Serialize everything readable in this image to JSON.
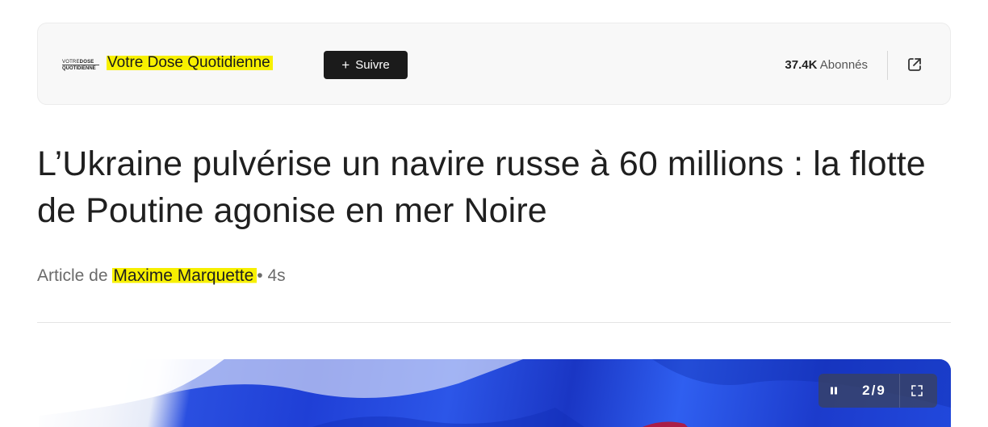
{
  "publisher": {
    "logo_line1_small": "VOTRE",
    "logo_line1_big": "DOSE",
    "logo_line2": "QUOTIDIENNE",
    "name": "Votre Dose Quotidienne",
    "follow_label": "Suivre",
    "follow_plus": "+",
    "subscriber_count": "37.4K",
    "subscriber_label": "Abonnés"
  },
  "article": {
    "headline": "L’Ukraine pulvérise un navire russe à 60 millions : la flotte de Poutine agonise en mer Noire",
    "byline_prefix": "Article de",
    "author": "Maxime Marquette",
    "separator": "•",
    "age": "4s"
  },
  "slideshow": {
    "counter": "2/9"
  },
  "icons": {
    "share": "external-link-icon",
    "pause": "pause-icon",
    "fullscreen": "fullscreen-icon"
  },
  "colors": {
    "highlight": "#f7f000",
    "follow_button": "#1b1b1b",
    "flag_blue": "#2148dc"
  }
}
